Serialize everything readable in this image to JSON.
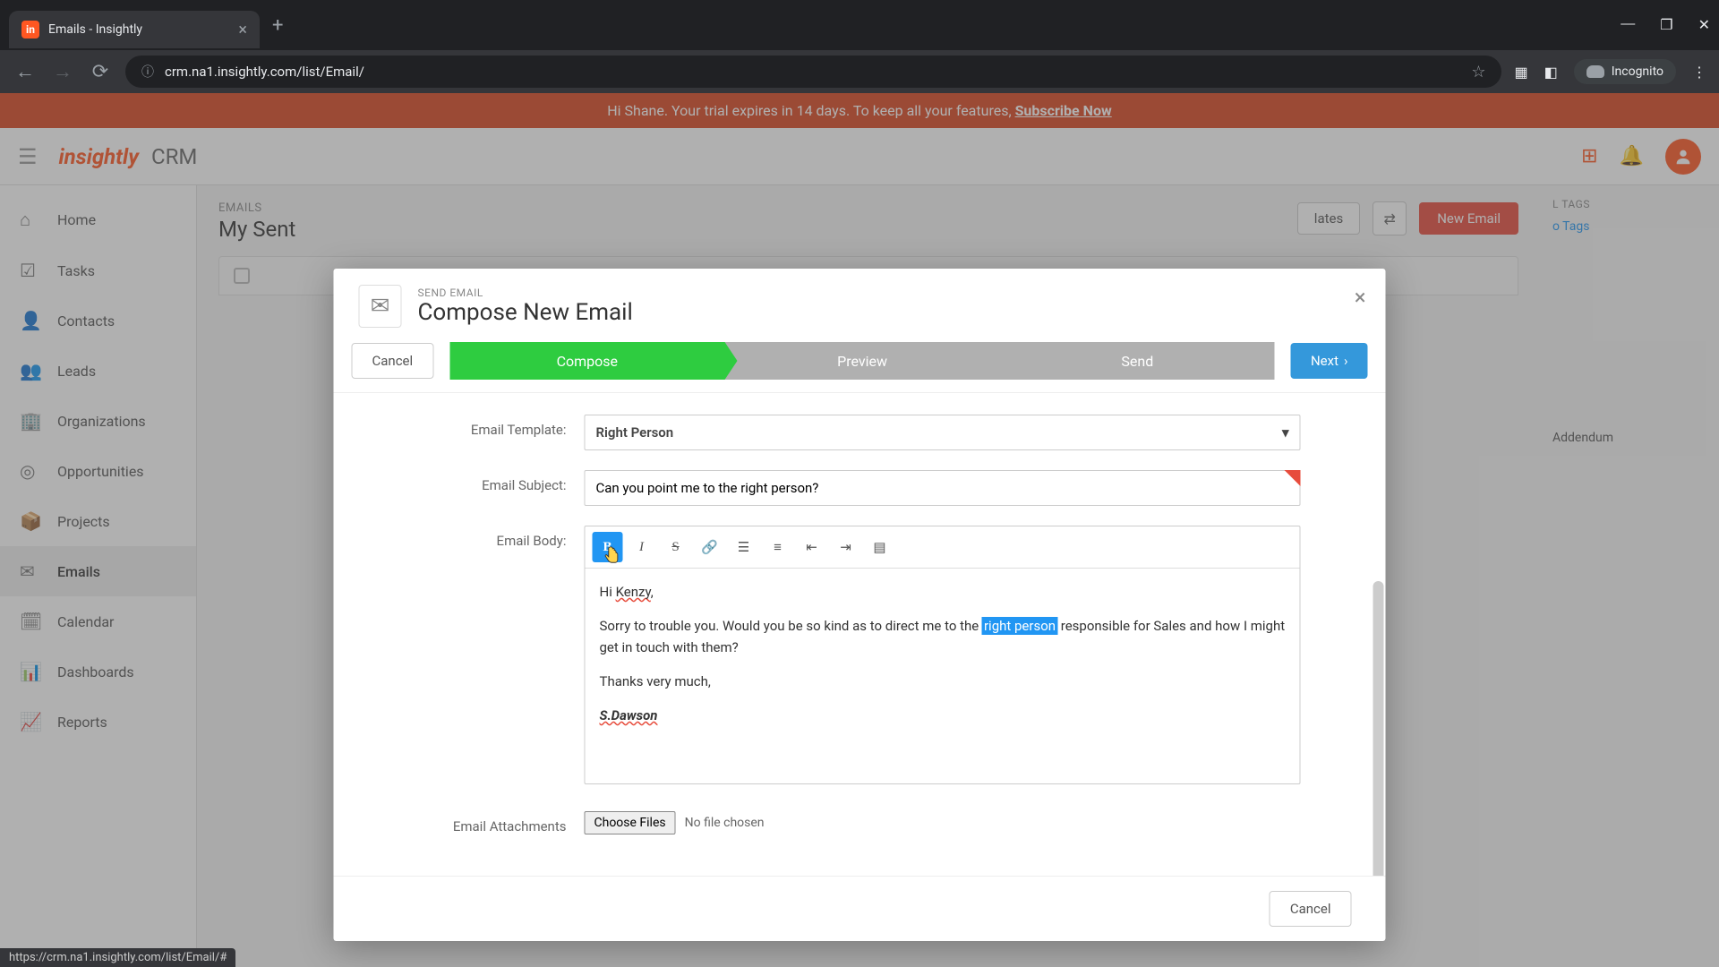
{
  "browser": {
    "tab_title": "Emails - Insightly",
    "url": "crm.na1.insightly.com/list/Email/",
    "incognito_label": "Incognito",
    "status_url": "https://crm.na1.insightly.com/list/Email/#"
  },
  "trial": {
    "message": "Hi Shane. Your trial expires in 14 days. To keep all your features, ",
    "link": "Subscribe Now"
  },
  "header": {
    "logo": "insightly",
    "product": "CRM"
  },
  "sidebar": {
    "items": [
      {
        "label": "Home",
        "icon": "⌂"
      },
      {
        "label": "Tasks",
        "icon": "☑"
      },
      {
        "label": "Contacts",
        "icon": "👤"
      },
      {
        "label": "Leads",
        "icon": "👥"
      },
      {
        "label": "Organizations",
        "icon": "🏢"
      },
      {
        "label": "Opportunities",
        "icon": "◎"
      },
      {
        "label": "Projects",
        "icon": "📦"
      },
      {
        "label": "Emails",
        "icon": "✉"
      },
      {
        "label": "Calendar",
        "icon": "🗓"
      },
      {
        "label": "Dashboards",
        "icon": "📊"
      },
      {
        "label": "Reports",
        "icon": "📈"
      }
    ]
  },
  "content": {
    "section_label": "EMAILS",
    "section_title": "My Sent",
    "templates_btn": "lates",
    "new_email_btn": "New Email"
  },
  "right_panel": {
    "tags_heading": "L TAGS",
    "no_tags": "o Tags",
    "addendum": "Addendum"
  },
  "modal": {
    "pre_title": "SEND EMAIL",
    "title": "Compose New Email",
    "cancel": "Cancel",
    "next": "Next",
    "steps": [
      "Compose",
      "Preview",
      "Send"
    ],
    "labels": {
      "template": "Email Template:",
      "subject": "Email Subject:",
      "body": "Email Body:",
      "attachments": "Email Attachments"
    },
    "template_value": "Right Person",
    "subject_value": "Can you point me to the right person?",
    "body": {
      "greeting_pre": "Hi ",
      "greeting_name": "Kenzy",
      "greeting_post": ",",
      "para_pre": "Sorry to trouble you. Would you be so kind as to direct me to the ",
      "selected": "right person",
      "para_post": " responsible for Sales and how I might get in touch with them?",
      "thanks": "Thanks very much,",
      "sig": "S.Dawson"
    },
    "file": {
      "button": "Choose Files",
      "status": "No file chosen"
    },
    "footer_cancel": "Cancel"
  }
}
